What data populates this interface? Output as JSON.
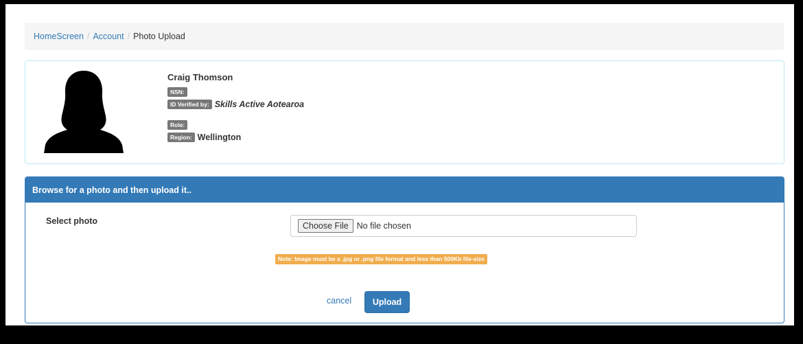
{
  "breadcrumb": {
    "home": "HomeScreen",
    "account": "Account",
    "current": "Photo Upload",
    "separator": "/"
  },
  "profile": {
    "name": "Craig Thomson",
    "nsn_label": "NSN:",
    "nsn_value": "",
    "id_verified_label": "ID Verified by:",
    "id_verified_value": "Skills Active Aotearoa",
    "role_label": "Role:",
    "role_value": "",
    "region_label": "Region:",
    "region_value": "Wellington",
    "avatar_icon": "person-silhouette-icon"
  },
  "upload": {
    "heading": "Browse for a photo and then upload it..",
    "select_label": "Select photo",
    "choose_button": "Choose File",
    "file_status": "No file chosen",
    "note": "Note: Image must be a .jpg or .png file format and less than 500Kb file-size",
    "cancel": "cancel",
    "upload_button": "Upload"
  },
  "colors": {
    "primary": "#337ab7",
    "info_border": "#bce8f1",
    "badge": "#777777",
    "warning": "#f0ad4e"
  }
}
